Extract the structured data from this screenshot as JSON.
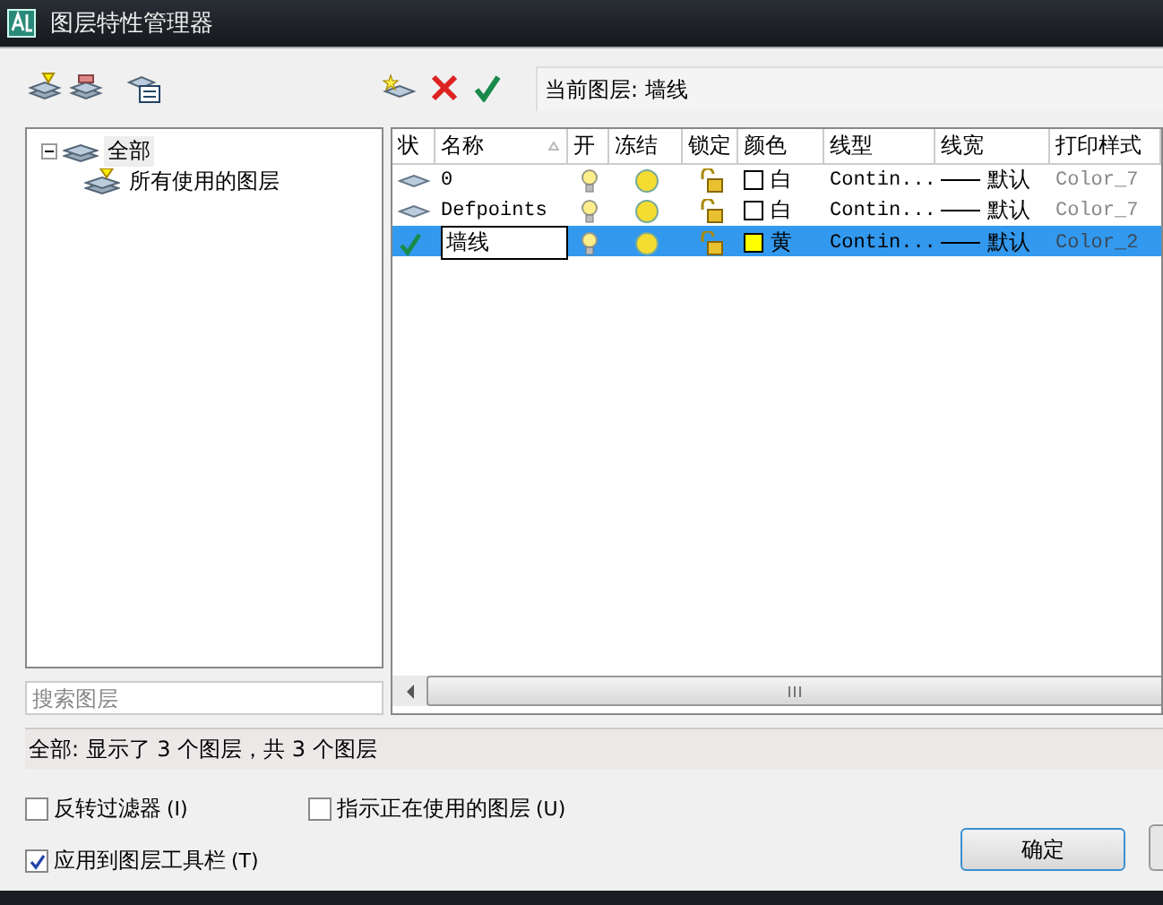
{
  "window": {
    "title": "图层特性管理器"
  },
  "current_layer": {
    "label": "当前图层:",
    "value": "墙线"
  },
  "tree": [
    {
      "label": "全部",
      "expanded": true,
      "selected": true,
      "children": [
        {
          "label": "所有使用的图层",
          "selected": false
        }
      ]
    }
  ],
  "search": {
    "placeholder": "搜索图层"
  },
  "table": {
    "columns": [
      {
        "label": "状",
        "sorted": false
      },
      {
        "label": "名称",
        "sorted": true
      },
      {
        "label": "开",
        "sorted": false
      },
      {
        "label": "冻结",
        "sorted": false
      },
      {
        "label": "锁定",
        "sorted": false
      },
      {
        "label": "颜色",
        "sorted": false
      },
      {
        "label": "线型",
        "sorted": false
      },
      {
        "label": "线宽",
        "sorted": false
      },
      {
        "label": "打印样式",
        "sorted": false
      }
    ],
    "rows": [
      {
        "kind": "layer",
        "name": "0",
        "on": true,
        "frozen": false,
        "locked": false,
        "color": "#ffffff",
        "color_name": "白",
        "linetype": "Contin...",
        "lineweight": "默认",
        "plot_style": "Color_7",
        "selected": false
      },
      {
        "kind": "layer",
        "name": "Defpoints",
        "on": true,
        "frozen": false,
        "locked": false,
        "color": "#ffffff",
        "color_name": "白",
        "linetype": "Contin...",
        "lineweight": "默认",
        "plot_style": "Color_7",
        "selected": false
      },
      {
        "kind": "current",
        "name": "墙线",
        "on": true,
        "frozen": false,
        "locked": false,
        "color": "#ffff00",
        "color_name": "黄",
        "linetype": "Contin...",
        "lineweight": "默认",
        "plot_style": "Color_2",
        "selected": true
      }
    ]
  },
  "status": "全部: 显示了 3 个图层，共 3 个图层",
  "options": [
    {
      "label": "反转过滤器",
      "key": "(I)",
      "checked": false
    },
    {
      "label": "指示正在使用的图层",
      "key": "(U)",
      "checked": false
    },
    {
      "label": "应用到图层工具栏",
      "key": "(T)",
      "checked": true
    }
  ],
  "buttons": [
    "确定"
  ]
}
